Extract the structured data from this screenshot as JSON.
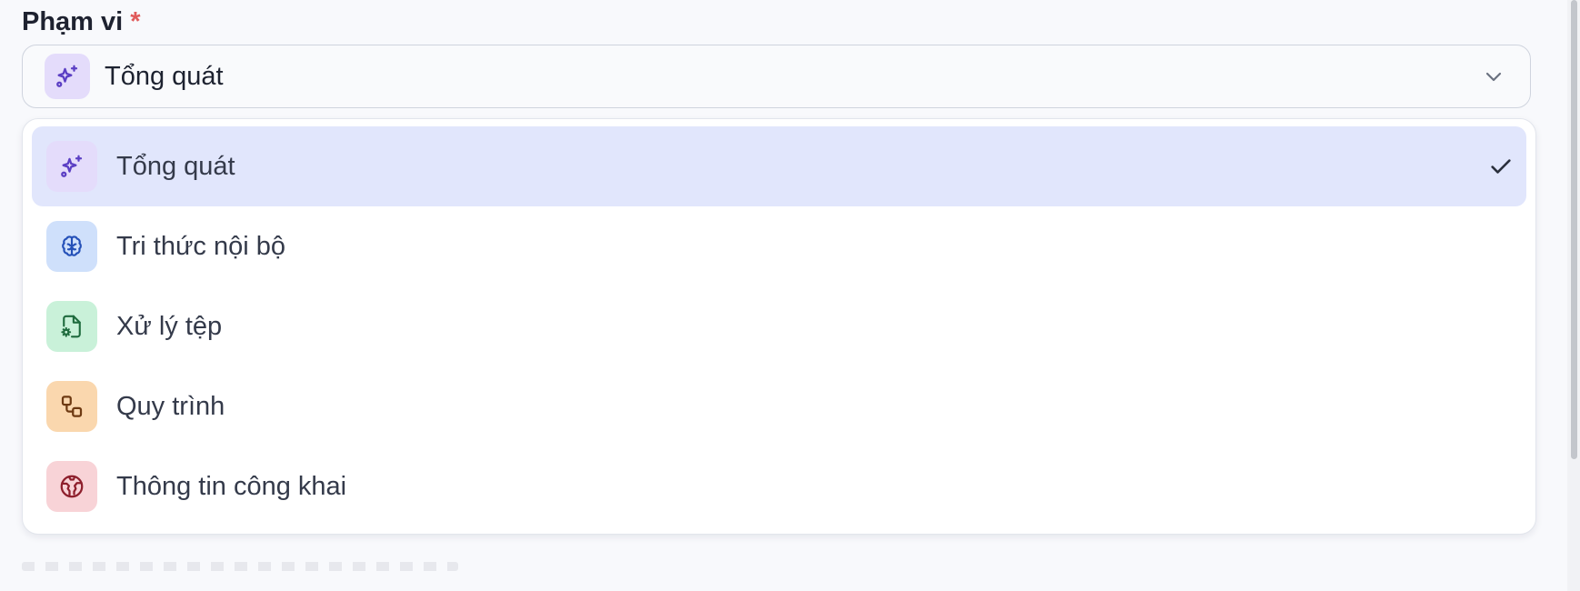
{
  "field": {
    "label": "Phạm vi",
    "required_marker": "*"
  },
  "select": {
    "selected_label": "Tổng quát",
    "selected_icon": "sparkles-icon"
  },
  "options": [
    {
      "label": "Tổng quát",
      "icon": "sparkles-icon",
      "color": "#e4dcfb",
      "selected": true
    },
    {
      "label": "Tri thức nội bộ",
      "icon": "brain-icon",
      "color": "#cfe0fb",
      "selected": false
    },
    {
      "label": "Xử lý tệp",
      "icon": "file-cog-icon",
      "color": "#c9f1d9",
      "selected": false
    },
    {
      "label": "Quy trình",
      "icon": "workflow-icon",
      "color": "#fad7ae",
      "selected": false
    },
    {
      "label": "Thông tin công khai",
      "icon": "globe-icon",
      "color": "#f8d3d7",
      "selected": false
    }
  ],
  "colors": {
    "selected_row": "#e1e6fc",
    "required": "#e05a5a",
    "border": "#cfd4de"
  }
}
